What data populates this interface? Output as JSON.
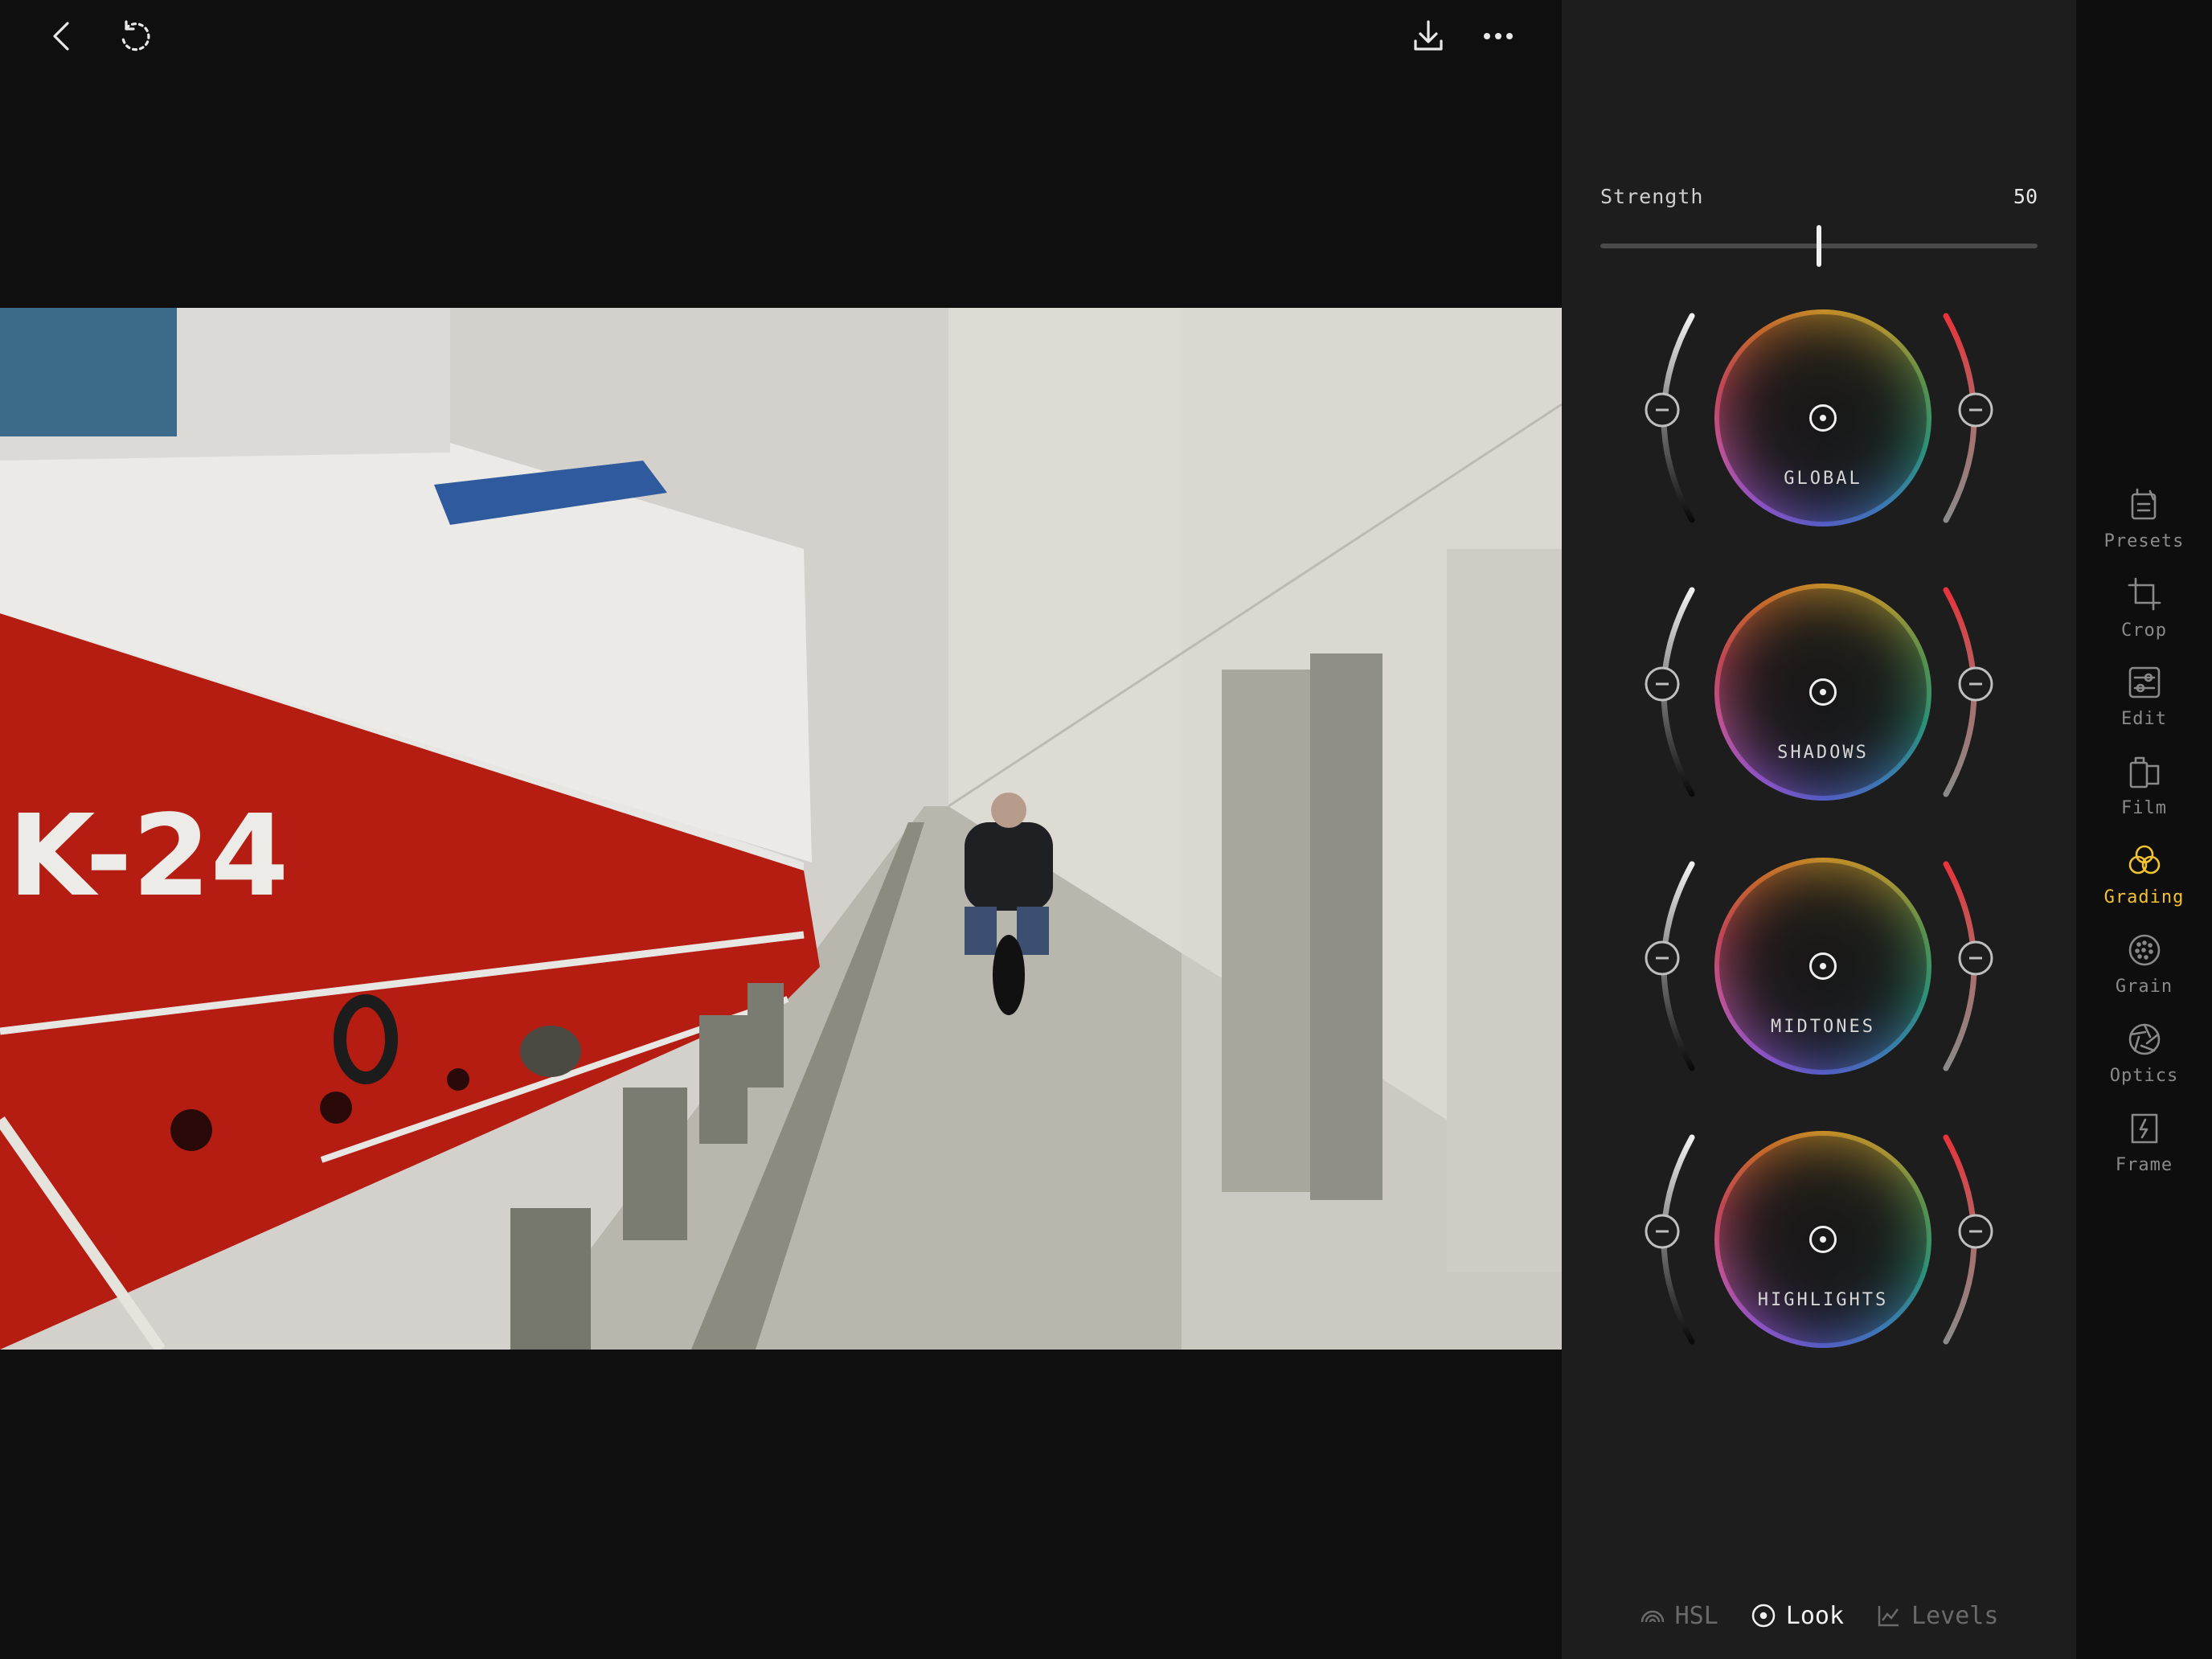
{
  "topbar": {
    "back_icon": "chevron-left-icon",
    "undo_icon": "undo-icon",
    "export_icon": "download-icon",
    "more_icon": "more-horizontal-icon"
  },
  "photo": {
    "hull_text": "K-24",
    "alt": "Harbor dock with red fishing boat and motorcyclist"
  },
  "panel": {
    "strength": {
      "label": "Strength",
      "value": "50",
      "fraction": 0.5
    },
    "wheels": [
      {
        "label": "GLOBAL"
      },
      {
        "label": "SHADOWS"
      },
      {
        "label": "MIDTONES"
      },
      {
        "label": "HIGHLIGHTS"
      }
    ],
    "tabs": [
      {
        "label": "HSL",
        "icon": "rainbow-icon",
        "active": false
      },
      {
        "label": "Look",
        "icon": "target-icon",
        "active": true
      },
      {
        "label": "Levels",
        "icon": "chart-line-icon",
        "active": false
      }
    ]
  },
  "rail": {
    "tools": [
      {
        "label": "Presets",
        "icon": "presets-icon"
      },
      {
        "label": "Crop",
        "icon": "crop-icon"
      },
      {
        "label": "Edit",
        "icon": "sliders-icon"
      },
      {
        "label": "Film",
        "icon": "film-icon"
      },
      {
        "label": "Grading",
        "icon": "grading-circles-icon",
        "active": true
      },
      {
        "label": "Grain",
        "icon": "grain-icon"
      },
      {
        "label": "Optics",
        "icon": "aperture-icon"
      },
      {
        "label": "Frame",
        "icon": "frame-icon"
      }
    ],
    "accent_color": "#f2c230"
  }
}
